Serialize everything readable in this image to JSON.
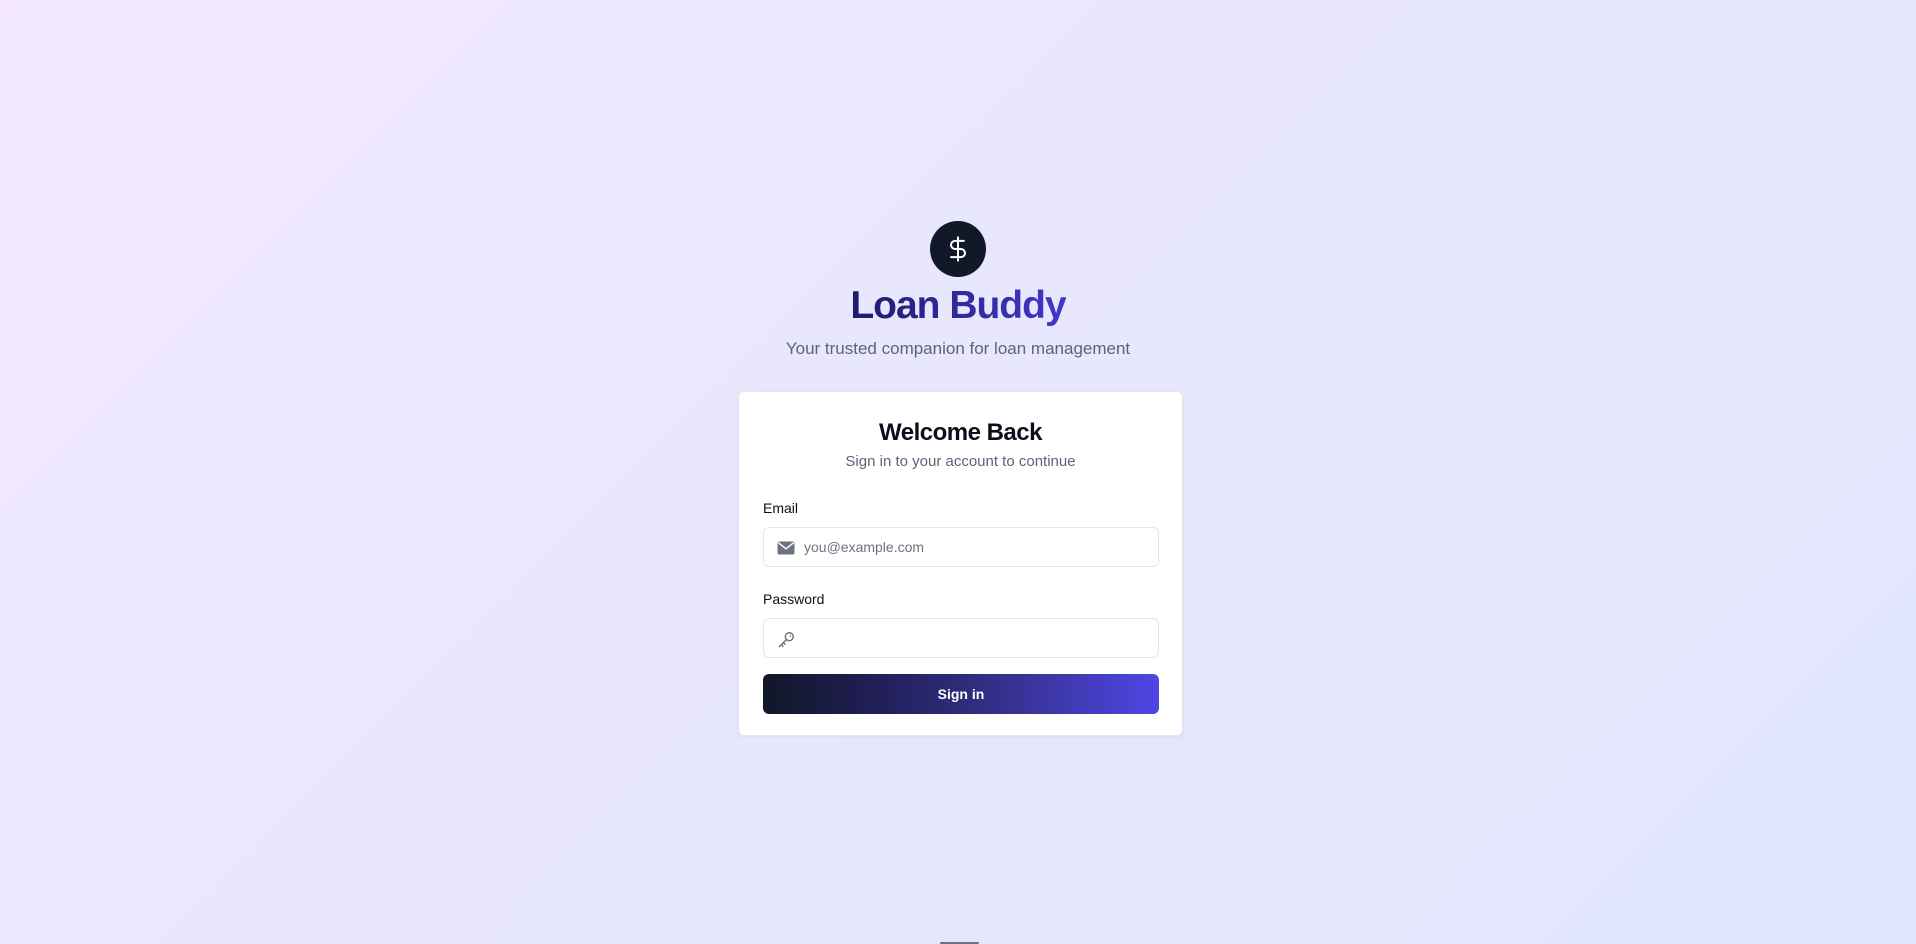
{
  "brand": {
    "logo_icon": "dollar-icon",
    "title": "Loan Buddy",
    "subtitle": "Your trusted companion for loan management"
  },
  "login_card": {
    "title": "Welcome Back",
    "subtitle": "Sign in to your account to continue",
    "email": {
      "label": "Email",
      "placeholder": "you@example.com",
      "value": "",
      "icon": "mail-icon"
    },
    "password": {
      "label": "Password",
      "placeholder": "",
      "value": "",
      "icon": "key-icon"
    },
    "submit_label": "Sign in"
  },
  "colors": {
    "logo_bg": "#111827",
    "title_gradient_start": "#1e1b6b",
    "title_gradient_end": "#4338ca",
    "button_gradient_start": "#111827",
    "button_gradient_end": "#4f46e5",
    "muted_text": "#5b6478"
  }
}
